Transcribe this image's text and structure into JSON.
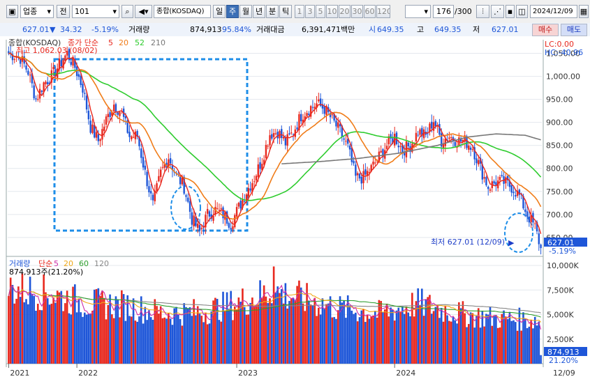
{
  "toolbar": {
    "market_type": "업종",
    "market_type_btn": "전",
    "code": "101",
    "name": "종합(KOSDAQ)",
    "periods": [
      "일",
      "주",
      "월",
      "년",
      "분",
      "틱"
    ],
    "active_period": "주",
    "intervals": [
      "1",
      "3",
      "5",
      "10",
      "20",
      "30",
      "60",
      "120"
    ],
    "count": "176",
    "count_total": "/300",
    "date": "2024/12/09"
  },
  "quote": {
    "price": "627.01",
    "change": "34.32",
    "change_pct": "-5.19%",
    "volume_label": "거래량",
    "volume": "874,913",
    "volume_ratio": "95.84%",
    "amount_label": "거래대금",
    "amount": "6,391,471백만",
    "open": "649.35",
    "high_label": "고",
    "high": "649.35",
    "low_label": "저",
    "low": "627.01",
    "buy_label": "매수",
    "sell_label": "매도"
  },
  "colors": {
    "up": "#e8281e",
    "down": "#1e56d8",
    "ma5": "#e8281e",
    "ma20": "#f07c18",
    "ma52": "#2ecc2e",
    "ma210": "#777777",
    "annotation": "#1e8ee8",
    "vol_ma5": "#cc2ea8",
    "vol_ma20": "#f0a818",
    "vol_ma60": "#2e9e2e",
    "vol_ma120": "#888888"
  },
  "chart_data": [
    {
      "type": "candlestick",
      "title": "종합(KOSDAQ)",
      "legend": [
        {
          "label": "종가 단순",
          "color": "#e8281e"
        },
        {
          "label": "5",
          "color": "#e8281e"
        },
        {
          "label": "20",
          "color": "#f07c18"
        },
        {
          "label": "52",
          "color": "#2ecc2e"
        },
        {
          "label": "210",
          "color": "#777777"
        }
      ],
      "high_note": "최고 1,062.03 (08/02)",
      "low_note": "최저 627.01 (12/09)",
      "lc": "LC:0.00",
      "hc": "HC:-40.96",
      "price_tag": "627.01",
      "pct_tag": "-5.19%",
      "ylim": [
        615,
        1075
      ],
      "y_ticks": [
        650,
        700,
        750,
        800,
        850,
        900,
        950,
        1000,
        1050
      ],
      "y_tick_labels": [
        "650.00",
        "700.00",
        "750.00",
        "800.00",
        "850.00",
        "900.00",
        "950.00",
        "1,000.00",
        "1,050.00"
      ],
      "x_labels": [
        {
          "label": "2021",
          "week": 0
        },
        {
          "label": "2022",
          "week": 35
        },
        {
          "label": "2023",
          "week": 117
        },
        {
          "label": "2024",
          "week": 198
        },
        {
          "label": "12/09",
          "week": 999
        }
      ],
      "close_keypoints": [
        [
          0,
          1050
        ],
        [
          6,
          1040
        ],
        [
          10,
          1010
        ],
        [
          14,
          950
        ],
        [
          18,
          985
        ],
        [
          22,
          1000
        ],
        [
          26,
          1025
        ],
        [
          30,
          1050
        ],
        [
          34,
          1020
        ],
        [
          38,
          975
        ],
        [
          42,
          890
        ],
        [
          46,
          860
        ],
        [
          50,
          905
        ],
        [
          54,
          940
        ],
        [
          58,
          920
        ],
        [
          62,
          870
        ],
        [
          66,
          870
        ],
        [
          70,
          790
        ],
        [
          74,
          720
        ],
        [
          78,
          790
        ],
        [
          82,
          825
        ],
        [
          86,
          785
        ],
        [
          90,
          760
        ],
        [
          94,
          690
        ],
        [
          98,
          662
        ],
        [
          102,
          700
        ],
        [
          106,
          710
        ],
        [
          110,
          700
        ],
        [
          114,
          680
        ],
        [
          118,
          715
        ],
        [
          122,
          750
        ],
        [
          126,
          780
        ],
        [
          130,
          820
        ],
        [
          134,
          875
        ],
        [
          138,
          880
        ],
        [
          142,
          855
        ],
        [
          146,
          880
        ],
        [
          150,
          915
        ],
        [
          154,
          930
        ],
        [
          158,
          940
        ],
        [
          162,
          930
        ],
        [
          166,
          905
        ],
        [
          170,
          880
        ],
        [
          174,
          845
        ],
        [
          178,
          780
        ],
        [
          182,
          780
        ],
        [
          186,
          800
        ],
        [
          190,
          825
        ],
        [
          194,
          850
        ],
        [
          198,
          870
        ],
        [
          202,
          840
        ],
        [
          206,
          850
        ],
        [
          210,
          880
        ],
        [
          214,
          870
        ],
        [
          218,
          905
        ],
        [
          222,
          860
        ],
        [
          226,
          870
        ],
        [
          230,
          860
        ],
        [
          234,
          860
        ],
        [
          238,
          845
        ],
        [
          242,
          800
        ],
        [
          246,
          760
        ],
        [
          250,
          770
        ],
        [
          254,
          770
        ],
        [
          258,
          760
        ],
        [
          262,
          740
        ],
        [
          266,
          700
        ],
        [
          270,
          672
        ],
        [
          273,
          627
        ]
      ],
      "ma210_keypoints": [
        [
          140,
          810
        ],
        [
          160,
          815
        ],
        [
          180,
          822
        ],
        [
          200,
          833
        ],
        [
          220,
          850
        ],
        [
          235,
          868
        ],
        [
          250,
          875
        ],
        [
          265,
          872
        ],
        [
          273,
          862
        ]
      ],
      "volume": {
        "legend": [
          {
            "label": "거래량",
            "color": "#1e56d8"
          },
          {
            "label": "단순",
            "color": "#e8281e"
          },
          {
            "label": "5",
            "color": "#cc2ea8"
          },
          {
            "label": "20",
            "color": "#f0a818"
          },
          {
            "label": "60",
            "color": "#2e9e2e"
          },
          {
            "label": "120",
            "color": "#888888"
          }
        ],
        "note": "874,913주(21.20%)",
        "vol_tag": "874,913",
        "vol_pct_tag": "21.20%",
        "ylim": [
          0,
          10500
        ],
        "y_ticks": [
          2500,
          5000,
          7500,
          10000
        ],
        "y_tick_labels": [
          "2,500K",
          "5,000K",
          "7,500K",
          "10,000K"
        ],
        "keypoints": [
          [
            0,
            7500
          ],
          [
            20,
            7000
          ],
          [
            40,
            6000
          ],
          [
            60,
            5800
          ],
          [
            80,
            5000
          ],
          [
            100,
            5200
          ],
          [
            117,
            6000
          ],
          [
            135,
            7200
          ],
          [
            150,
            6500
          ],
          [
            170,
            5500
          ],
          [
            190,
            5000
          ],
          [
            210,
            6000
          ],
          [
            230,
            5000
          ],
          [
            250,
            4500
          ],
          [
            273,
            4300
          ]
        ],
        "last": 874
      }
    }
  ]
}
